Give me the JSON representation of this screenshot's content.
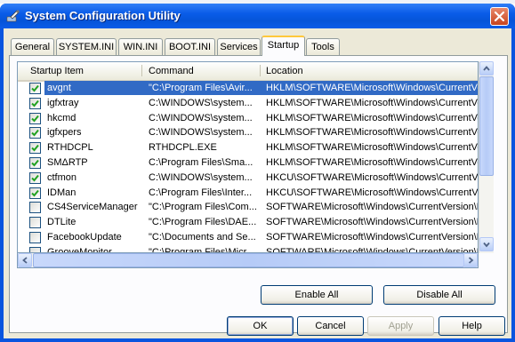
{
  "window": {
    "title": "System Configuration Utility",
    "icon": "msconfig-icon",
    "close_icon": "close-icon"
  },
  "tabs": [
    {
      "label": "General",
      "active": false
    },
    {
      "label": "SYSTEM.INI",
      "active": false
    },
    {
      "label": "WIN.INI",
      "active": false
    },
    {
      "label": "BOOT.INI",
      "active": false
    },
    {
      "label": "Services",
      "active": false
    },
    {
      "label": "Startup",
      "active": true
    },
    {
      "label": "Tools",
      "active": false
    }
  ],
  "startup_list": {
    "columns": [
      "Startup Item",
      "Command",
      "Location"
    ],
    "rows": [
      {
        "item": "avgnt",
        "command": "\"C:\\Program Files\\Avir...",
        "location": "HKLM\\SOFTWARE\\Microsoft\\Windows\\CurrentVer...",
        "checked": true,
        "selected": true
      },
      {
        "item": "igfxtray",
        "command": "C:\\WINDOWS\\system...",
        "location": "HKLM\\SOFTWARE\\Microsoft\\Windows\\CurrentVer...",
        "checked": true,
        "selected": false
      },
      {
        "item": "hkcmd",
        "command": "C:\\WINDOWS\\system...",
        "location": "HKLM\\SOFTWARE\\Microsoft\\Windows\\CurrentVer...",
        "checked": true,
        "selected": false
      },
      {
        "item": "igfxpers",
        "command": "C:\\WINDOWS\\system...",
        "location": "HKLM\\SOFTWARE\\Microsoft\\Windows\\CurrentVer...",
        "checked": true,
        "selected": false
      },
      {
        "item": "RTHDCPL",
        "command": "RTHDCPL.EXE",
        "location": "HKLM\\SOFTWARE\\Microsoft\\Windows\\CurrentVer...",
        "checked": true,
        "selected": false
      },
      {
        "item": "SMΔRTP",
        "command": "C:\\Program Files\\Sma...",
        "location": "HKLM\\SOFTWARE\\Microsoft\\Windows\\CurrentVer...",
        "checked": true,
        "selected": false
      },
      {
        "item": "ctfmon",
        "command": "C:\\WINDOWS\\system...",
        "location": "HKCU\\SOFTWARE\\Microsoft\\Windows\\CurrentVer...",
        "checked": true,
        "selected": false
      },
      {
        "item": "IDMan",
        "command": "C:\\Program Files\\Inter...",
        "location": "HKCU\\SOFTWARE\\Microsoft\\Windows\\CurrentVer...",
        "checked": true,
        "selected": false
      },
      {
        "item": "CS4ServiceManager",
        "command": "\"C:\\Program Files\\Com...",
        "location": "SOFTWARE\\Microsoft\\Windows\\CurrentVersion\\Ru",
        "checked": false,
        "selected": false
      },
      {
        "item": "DTLite",
        "command": "\"C:\\Program Files\\DAE...",
        "location": "SOFTWARE\\Microsoft\\Windows\\CurrentVersion\\Ru",
        "checked": false,
        "selected": false
      },
      {
        "item": "FacebookUpdate",
        "command": "\"C:\\Documents and Se...",
        "location": "SOFTWARE\\Microsoft\\Windows\\CurrentVersion\\Ru",
        "checked": false,
        "selected": false
      },
      {
        "item": "GrooveMonitor",
        "command": "\"C:\\Program Files\\Micr...",
        "location": "SOFTWARE\\Microsoft\\Windows\\CurrentVersion\\Ru",
        "checked": false,
        "selected": false
      }
    ]
  },
  "panel_buttons": {
    "enable_all": "Enable All",
    "disable_all": "Disable All"
  },
  "dialog_buttons": {
    "ok": "OK",
    "cancel": "Cancel",
    "apply": "Apply",
    "help": "Help"
  },
  "colors": {
    "titlebar": "#0a5ce8",
    "selection": "#316ac5",
    "face": "#ece9d8",
    "close": "#c8441e"
  }
}
